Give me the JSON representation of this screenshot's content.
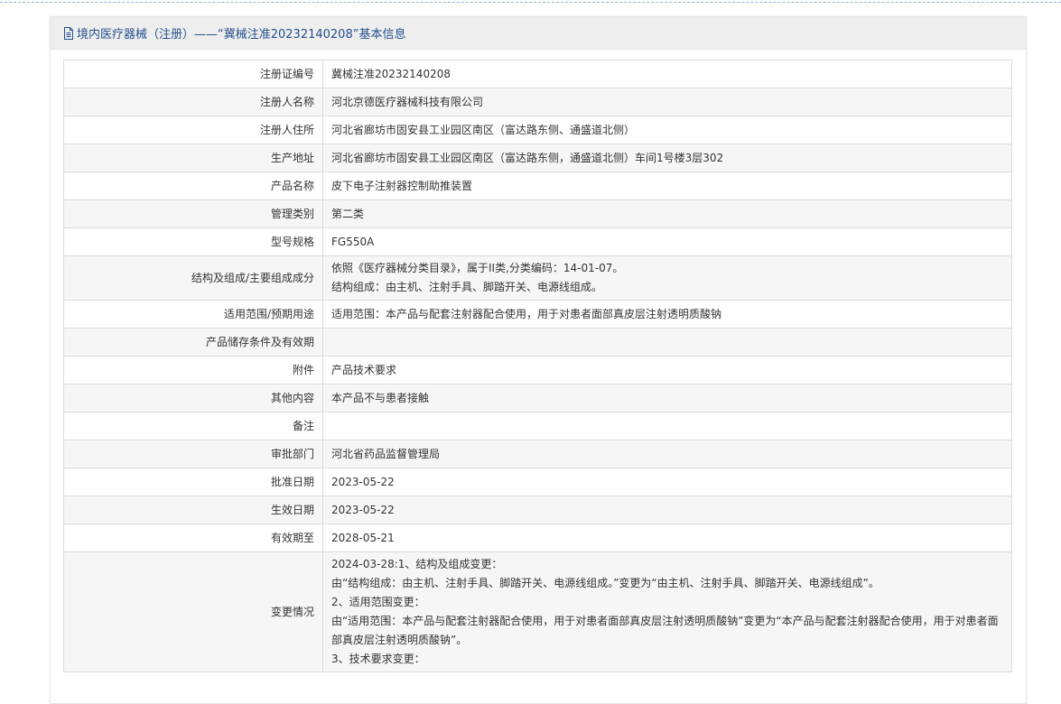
{
  "header": {
    "title": "境内医疗器械（注册）——“冀械注准20232140208”基本信息",
    "icon": "document-icon"
  },
  "rows": [
    {
      "label": "注册证编号",
      "value": "冀械注准20232140208"
    },
    {
      "label": "注册人名称",
      "value": "河北京德医疗器械科技有限公司"
    },
    {
      "label": "注册人住所",
      "value": "河北省廊坊市固安县工业园区南区（富达路东侧、通盛道北侧）"
    },
    {
      "label": "生产地址",
      "value": "河北省廊坊市固安县工业园区南区（富达路东侧，通盛道北侧）车间1号楼3层302"
    },
    {
      "label": "产品名称",
      "value": "皮下电子注射器控制助推装置"
    },
    {
      "label": "管理类别",
      "value": "第二类"
    },
    {
      "label": "型号规格",
      "value": "FG550A"
    },
    {
      "label": "结构及组成/主要组成成分",
      "lines": [
        "依照《医疗器械分类目录》，属于II类,分类编码：14-01-07。",
        "结构组成：由主机、注射手具、脚踏开关、电源线组成。"
      ]
    },
    {
      "label": "适用范围/预期用途",
      "value": "适用范围：本产品与配套注射器配合使用，用于对患者面部真皮层注射透明质酸钠"
    },
    {
      "label": "产品储存条件及有效期",
      "value": ""
    },
    {
      "label": "附件",
      "value": "产品技术要求"
    },
    {
      "label": "其他内容",
      "value": "本产品不与患者接触"
    },
    {
      "label": "备注",
      "value": ""
    },
    {
      "label": "审批部门",
      "value": "河北省药品监督管理局"
    },
    {
      "label": "批准日期",
      "value": "2023-05-22"
    },
    {
      "label": "生效日期",
      "value": "2023-05-22"
    },
    {
      "label": "有效期至",
      "value": "2028-05-21"
    },
    {
      "label": "变更情况",
      "lines": [
        "2024-03-28:1、结构及组成变更：",
        "由“结构组成：由主机、注射手具、脚踏开关、电源线组成。”变更为“由主机、注射手具、脚踏开关、电源线组成”。",
        "2、适用范围变更：",
        "由“适用范围：本产品与配套注射器配合使用，用于对患者面部真皮层注射透明质酸钠”变更为“本产品与配套注射器配合使用，用于对患者面部真皮层注射透明质酸钠”。",
        "3、技术要求变更："
      ]
    }
  ],
  "colors": {
    "header_text": "#25508d",
    "header_bg": "#eeeeee",
    "border": "#dcdcdc",
    "stripe": "#f6f6f6"
  }
}
